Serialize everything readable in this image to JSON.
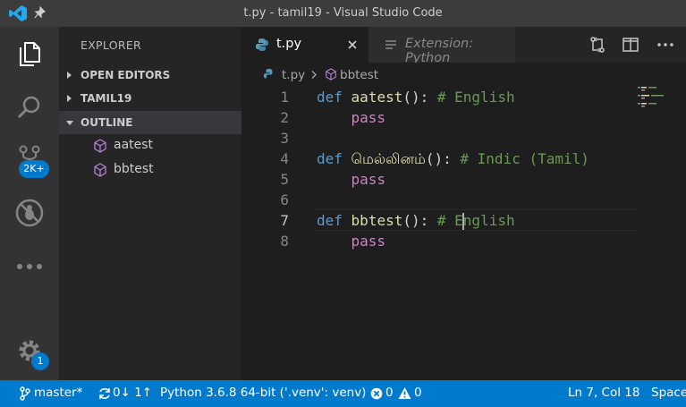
{
  "window": {
    "title": "t.py - tamil19 - Visual Studio Code"
  },
  "activity_bar": {
    "source_control_badge": "2K+",
    "manage_badge": "1"
  },
  "sidebar": {
    "header": "EXPLORER",
    "sections": [
      {
        "label": "OPEN EDITORS",
        "expanded": false
      },
      {
        "label": "TAMIL19",
        "expanded": false
      },
      {
        "label": "OUTLINE",
        "expanded": true
      }
    ],
    "outline_items": [
      "aatest",
      "bbtest"
    ]
  },
  "tabs": [
    {
      "label": "t.py",
      "active": true
    },
    {
      "label": "Extension: Python",
      "active": false
    }
  ],
  "breadcrumb": {
    "file": "t.py",
    "symbol": "bbtest"
  },
  "editor": {
    "line_numbers": [
      "1",
      "2",
      "3",
      "4",
      "5",
      "6",
      "7",
      "8"
    ],
    "current_line": "7",
    "lines": [
      {
        "kw": "def",
        "fn": "aatest",
        "paren": "():",
        "comment": "# English"
      },
      {
        "ctl": "pass"
      },
      {},
      {
        "kw": "def",
        "fn": "மெல்லினம்",
        "paren": "():",
        "comment": "# Indic (Tamil)"
      },
      {
        "ctl": "pass"
      },
      {},
      {
        "kw": "def",
        "fn": "bbtest",
        "paren": "():",
        "comment_pre": "# E",
        "comment_post": "nglish"
      },
      {
        "ctl": "pass"
      }
    ]
  },
  "status_bar": {
    "branch": "master*",
    "sync": "0↓ 1↑",
    "interpreter": "Python 3.6.8 64-bit ('.venv': venv)",
    "errors": "0",
    "warnings": "0",
    "position": "Ln 7, Col 18",
    "indent": "Space"
  },
  "colors": {
    "accent": "#007acc",
    "keyword": "#569cd6",
    "function": "#dcdcaa",
    "comment": "#6a9955",
    "control": "#c586c0",
    "outline_icon": "#b180d7"
  }
}
